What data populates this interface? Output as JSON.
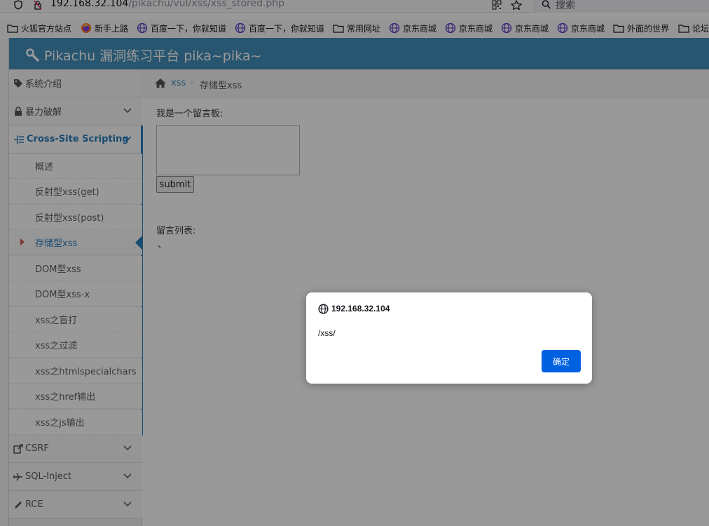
{
  "browser": {
    "url_host": "192.168.32.104",
    "url_path": "/pikachu/vul/xss/xss_stored.php",
    "search_placeholder": "搜索"
  },
  "bookmarks": [
    {
      "label": "火狐官方站点",
      "icon": "folder-icon"
    },
    {
      "label": "新手上路",
      "icon": "firefox-icon"
    },
    {
      "label": "百度一下，你就知道",
      "icon": "globe-icon"
    },
    {
      "label": "百度一下，你就知道",
      "icon": "globe-icon"
    },
    {
      "label": "常用网址",
      "icon": "folder-icon"
    },
    {
      "label": "京东商城",
      "icon": "globe-icon"
    },
    {
      "label": "京东商城",
      "icon": "globe-icon"
    },
    {
      "label": "京东商城",
      "icon": "globe-icon"
    },
    {
      "label": "京东商城",
      "icon": "globe-icon"
    },
    {
      "label": "外面的世界",
      "icon": "folder-icon"
    },
    {
      "label": "论坛",
      "icon": "folder-icon"
    }
  ],
  "app": {
    "title": "Pikachu 漏洞练习平台 pika~pika~"
  },
  "sidebar": {
    "top": [
      {
        "label": "系统介绍",
        "icon": "tags-icon"
      },
      {
        "label": "暴力破解",
        "icon": "lock-icon"
      },
      {
        "label": "Cross-Site Scripting",
        "icon": "list-icon"
      }
    ],
    "sub": [
      "概述",
      "反射型xss(get)",
      "反射型xss(post)",
      "存储型xss",
      "DOM型xss",
      "DOM型xss-x",
      "xss之盲打",
      "xss之过滤",
      "xss之htmlspecialchars",
      "xss之href输出",
      "xss之js输出"
    ],
    "bottom": [
      {
        "label": "CSRF",
        "icon": "share-icon"
      },
      {
        "label": "SQL-Inject",
        "icon": "plane-icon"
      },
      {
        "label": "RCE",
        "icon": "pencil-icon"
      }
    ]
  },
  "breadcrumb": {
    "section": "xss",
    "separator": "›",
    "current": "存储型xss"
  },
  "board": {
    "label": "我是一个留言板:",
    "textarea_value": "",
    "submit_label": "submit",
    "list_label": "留言列表:",
    "list_item": "、"
  },
  "dialog": {
    "title": "192.168.32.104",
    "message": "/xss/",
    "ok_label": "确定"
  },
  "colors": {
    "navbar": "#438eb9",
    "link": "#2b7dbc",
    "dialog_button": "#0061e0"
  }
}
